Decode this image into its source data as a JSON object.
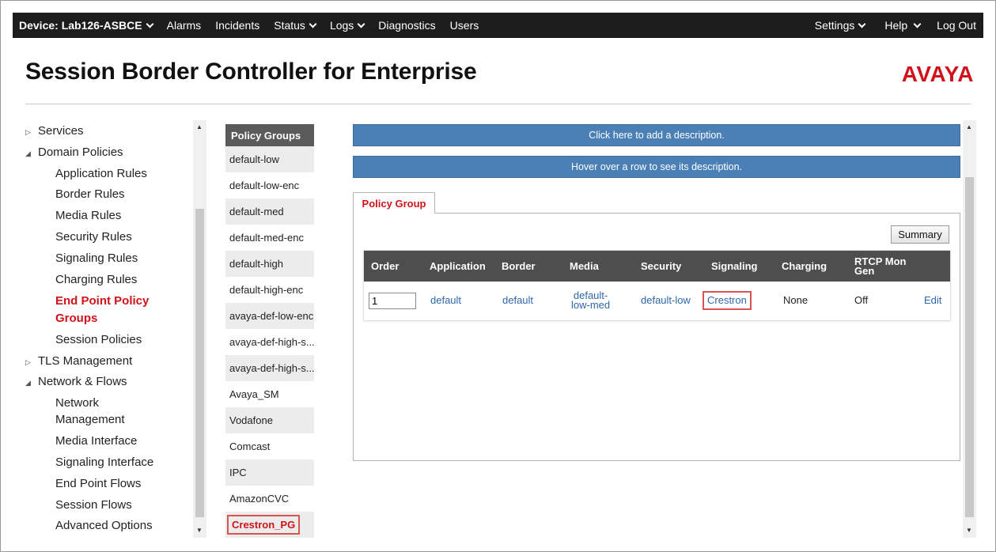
{
  "topnav": {
    "device": "Device: Lab126-ASBCE",
    "alarms": "Alarms",
    "incidents": "Incidents",
    "status": "Status",
    "logs": "Logs",
    "diagnostics": "Diagnostics",
    "users": "Users",
    "settings": "Settings",
    "help": "Help",
    "logout": "Log Out"
  },
  "header": {
    "title": "Session Border Controller for Enterprise",
    "logo": "AVAYA"
  },
  "sidebar": {
    "items": [
      {
        "label": "Services",
        "expander": "▷"
      },
      {
        "label": "Domain Policies",
        "expander": "◢"
      },
      {
        "label": "Application Rules"
      },
      {
        "label": "Border Rules"
      },
      {
        "label": "Media Rules"
      },
      {
        "label": "Security Rules"
      },
      {
        "label": "Signaling Rules"
      },
      {
        "label": "Charging Rules"
      },
      {
        "label": "End Point Policy"
      },
      {
        "label": "Groups"
      },
      {
        "label": "Session Policies"
      },
      {
        "label": "TLS Management",
        "expander": "▷"
      },
      {
        "label": "Network & Flows",
        "expander": "◢"
      },
      {
        "label": "Network"
      },
      {
        "label": "Management"
      },
      {
        "label": "Media Interface"
      },
      {
        "label": "Signaling Interface"
      },
      {
        "label": "End Point Flows"
      },
      {
        "label": "Session Flows"
      },
      {
        "label": "Advanced Options"
      }
    ]
  },
  "policy_groups": {
    "header": "Policy Groups",
    "items": [
      "default-low",
      "default-low-enc",
      "default-med",
      "default-med-enc",
      "default-high",
      "default-high-enc",
      "avaya-def-low-enc",
      "avaya-def-high-s...",
      "avaya-def-high-s...",
      "Avaya_SM",
      "Vodafone",
      "Comcast",
      "IPC",
      "AmazonCVC",
      "Crestron_PG"
    ]
  },
  "main": {
    "description_banner": "Click here to add a description.",
    "hover_banner": "Hover over a row to see its description.",
    "tab": "Policy Group",
    "summary_button": "Summary",
    "table": {
      "headers": {
        "order": "Order",
        "application": "Application",
        "border": "Border",
        "media": "Media",
        "security": "Security",
        "signaling": "Signaling",
        "charging": "Charging",
        "rtcp1": "RTCP Mon",
        "rtcp2": "Gen"
      },
      "row": {
        "order": "1",
        "application": "default",
        "border": "default",
        "media1": "default-",
        "media2": "low-med",
        "security": "default-low",
        "signaling": "Crestron",
        "charging": "None",
        "rtcp": "Off",
        "edit": "Edit"
      }
    }
  },
  "colors": {
    "accent_red": "#d1121b",
    "banner_blue": "#4a80b5",
    "nav_dark": "#1d1d1d",
    "link_blue": "#2f67a8"
  }
}
